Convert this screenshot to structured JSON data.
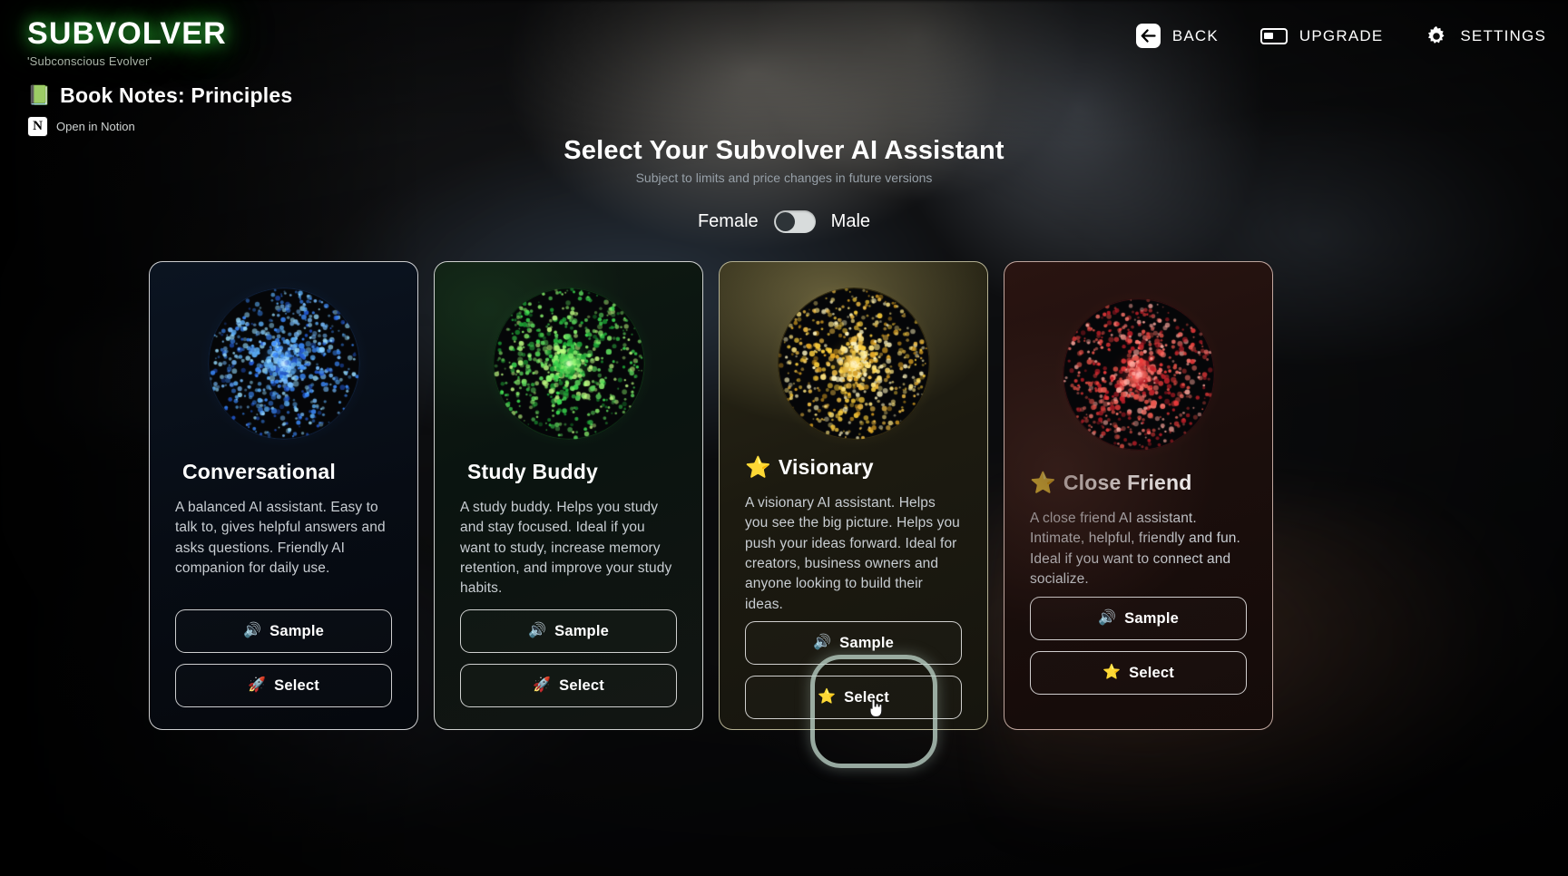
{
  "brand": {
    "title": "SUBVOLVER",
    "tagline": "'Subconscious Evolver'",
    "accent_color": "#3cdc46"
  },
  "document": {
    "emoji": "📗",
    "title": "Book Notes: Principles",
    "notion_link_label": "Open in Notion",
    "notion_mark": "N"
  },
  "topnav": {
    "items": [
      {
        "label": "BACK",
        "icon": "back-arrow-icon"
      },
      {
        "label": "UPGRADE",
        "icon": "battery-icon"
      },
      {
        "label": "SETTINGS",
        "icon": "gear-icon"
      }
    ]
  },
  "header": {
    "title": "Select Your Subvolver AI Assistant",
    "subtitle": "Subject to limits and price changes in future versions"
  },
  "gender_toggle": {
    "left_label": "Female",
    "right_label": "Male",
    "selected": "Female",
    "knob_position": "left"
  },
  "assistants": [
    {
      "name": "Conversational",
      "badge": "",
      "description": "A balanced AI assistant. Easy to talk to, gives helpful answers and asks questions. Friendly AI companion for daily use.",
      "sample_label": "Sample",
      "sample_emoji": "🔊",
      "select_label": "Select",
      "select_emoji": "🚀",
      "accent_color": "#2f86ff",
      "theme": "blue"
    },
    {
      "name": "Study Buddy",
      "badge": "",
      "description": "A study buddy. Helps you study and stay focused. Ideal if you want to study, increase memory retention, and improve your study habits.",
      "sample_label": "Sample",
      "sample_emoji": "🔊",
      "select_label": "Select",
      "select_emoji": "🚀",
      "accent_color": "#2fd94a",
      "theme": "green"
    },
    {
      "name": "Visionary",
      "badge": "⭐",
      "description": "A visionary AI assistant. Helps you see the big picture. Helps you push your ideas forward. Ideal for creators, business owners and anyone looking to build their ideas.",
      "sample_label": "Sample",
      "sample_emoji": "🔊",
      "select_label": "Select",
      "select_emoji": "⭐",
      "accent_color": "#f5cc38",
      "theme": "gold"
    },
    {
      "name": "Close Friend",
      "badge": "⭐",
      "description": "A close friend AI assistant. Intimate, helpful, friendly and fun. Ideal if you want to connect and socialize.",
      "sample_label": "Sample",
      "sample_emoji": "🔊",
      "select_label": "Select",
      "select_emoji": "⭐",
      "accent_color": "#f03b3b",
      "theme": "red"
    }
  ],
  "interaction": {
    "highlight_target": "Visionary Select button",
    "highlight_color": "#bad1c6",
    "cursor": "pointer-hand"
  }
}
